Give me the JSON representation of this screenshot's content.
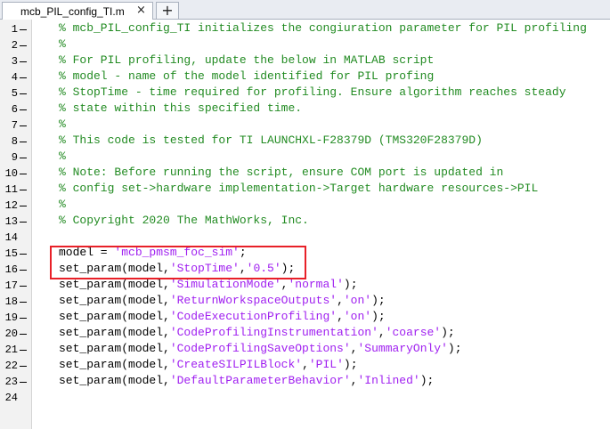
{
  "tab": {
    "title": "mcb_PIL_config_TI.m",
    "close_glyph": "×",
    "add_glyph": "+"
  },
  "lines": [
    {
      "n": "1",
      "comment": "% mcb_PIL_config_TI initializes the congiuration parameter for PIL profiling"
    },
    {
      "n": "2",
      "comment": "%"
    },
    {
      "n": "3",
      "comment": "% For PIL profiling, update the below in MATLAB script"
    },
    {
      "n": "4",
      "comment": "% model - name of the model identified for PIL profing"
    },
    {
      "n": "5",
      "comment": "% StopTime - time required for profiling. Ensure algorithm reaches steady"
    },
    {
      "n": "6",
      "comment": "% state within this specified time."
    },
    {
      "n": "7",
      "comment": "%"
    },
    {
      "n": "8",
      "comment": "% This code is tested for TI LAUNCHXL-F28379D (TMS320F28379D)"
    },
    {
      "n": "9",
      "comment": "%"
    },
    {
      "n": "10",
      "comment": "% Note: Before running the script, ensure COM port is updated in"
    },
    {
      "n": "11",
      "comment": "% config set->hardware implementation->Target hardware resources->PIL"
    },
    {
      "n": "12",
      "comment": "%"
    },
    {
      "n": "13",
      "comment": "% Copyright 2020 The MathWorks, Inc."
    },
    {
      "n": "14"
    },
    {
      "n": "15",
      "code": [
        {
          "t": "model = "
        },
        {
          "s": "'mcb_pmsm_foc_sim'"
        },
        {
          "t": ";"
        }
      ]
    },
    {
      "n": "16",
      "code": [
        {
          "t": "set_param(model,"
        },
        {
          "s": "'StopTime'"
        },
        {
          "t": ","
        },
        {
          "s": "'0.5'"
        },
        {
          "t": ");"
        }
      ]
    },
    {
      "n": "17",
      "code": [
        {
          "t": "set_param(model,"
        },
        {
          "s": "'SimulationMode'"
        },
        {
          "t": ","
        },
        {
          "s": "'normal'"
        },
        {
          "t": ");"
        }
      ]
    },
    {
      "n": "18",
      "code": [
        {
          "t": "set_param(model,"
        },
        {
          "s": "'ReturnWorkspaceOutputs'"
        },
        {
          "t": ","
        },
        {
          "s": "'on'"
        },
        {
          "t": ");"
        }
      ]
    },
    {
      "n": "19",
      "code": [
        {
          "t": "set_param(model,"
        },
        {
          "s": "'CodeExecutionProfiling'"
        },
        {
          "t": ","
        },
        {
          "s": "'on'"
        },
        {
          "t": ");"
        }
      ]
    },
    {
      "n": "20",
      "code": [
        {
          "t": "set_param(model,"
        },
        {
          "s": "'CodeProfilingInstrumentation'"
        },
        {
          "t": ","
        },
        {
          "s": "'coarse'"
        },
        {
          "t": ");"
        }
      ]
    },
    {
      "n": "21",
      "code": [
        {
          "t": "set_param(model,"
        },
        {
          "s": "'CodeProfilingSaveOptions'"
        },
        {
          "t": ","
        },
        {
          "s": "'SummaryOnly'"
        },
        {
          "t": ");"
        }
      ]
    },
    {
      "n": "22",
      "code": [
        {
          "t": "set_param(model,"
        },
        {
          "s": "'CreateSILPILBlock'"
        },
        {
          "t": ","
        },
        {
          "s": "'PIL'"
        },
        {
          "t": ");"
        }
      ]
    },
    {
      "n": "23",
      "code": [
        {
          "t": "set_param(model,"
        },
        {
          "s": "'DefaultParameterBehavior'"
        },
        {
          "t": ","
        },
        {
          "s": "'Inlined'"
        },
        {
          "t": ");"
        }
      ]
    },
    {
      "n": "24"
    }
  ],
  "colors": {
    "comment": "#228b22",
    "string": "#a020f0",
    "highlight": "#e82028"
  }
}
